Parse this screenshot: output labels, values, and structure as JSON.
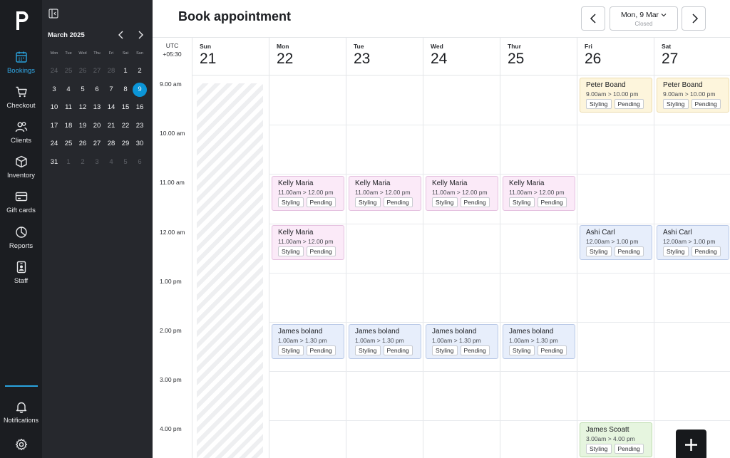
{
  "nav": {
    "items": [
      {
        "label": "Bookings",
        "icon": "calendar-icon"
      },
      {
        "label": "Checkout",
        "icon": "cart-icon"
      },
      {
        "label": "Clients",
        "icon": "users-icon"
      },
      {
        "label": "Inventory",
        "icon": "box-icon"
      },
      {
        "label": "Gift cards",
        "icon": "card-icon"
      },
      {
        "label": "Reports",
        "icon": "pie-chart-icon"
      },
      {
        "label": "Staff",
        "icon": "badge-icon"
      }
    ],
    "bottom": [
      {
        "label": "Notifications",
        "icon": "bell-icon"
      },
      {
        "label": "",
        "icon": "gear-icon"
      }
    ],
    "accent": "#2aa3de"
  },
  "mini_calendar": {
    "month": "March 2025",
    "weekdays": [
      "Mon",
      "Tue",
      "Wed",
      "Thu",
      "Fri",
      "Sat",
      "Sun"
    ],
    "days": [
      {
        "d": "24",
        "muted": true
      },
      {
        "d": "25",
        "muted": true
      },
      {
        "d": "26",
        "muted": true
      },
      {
        "d": "27",
        "muted": true
      },
      {
        "d": "28",
        "muted": true
      },
      {
        "d": "1"
      },
      {
        "d": "2"
      },
      {
        "d": "3"
      },
      {
        "d": "4"
      },
      {
        "d": "5"
      },
      {
        "d": "6"
      },
      {
        "d": "7"
      },
      {
        "d": "8"
      },
      {
        "d": "9",
        "selected": true
      },
      {
        "d": "10"
      },
      {
        "d": "11"
      },
      {
        "d": "12"
      },
      {
        "d": "13"
      },
      {
        "d": "14"
      },
      {
        "d": "15"
      },
      {
        "d": "16"
      },
      {
        "d": "17"
      },
      {
        "d": "18"
      },
      {
        "d": "19"
      },
      {
        "d": "20"
      },
      {
        "d": "21"
      },
      {
        "d": "22"
      },
      {
        "d": "23"
      },
      {
        "d": "24"
      },
      {
        "d": "25"
      },
      {
        "d": "26"
      },
      {
        "d": "27"
      },
      {
        "d": "28"
      },
      {
        "d": "29"
      },
      {
        "d": "30"
      },
      {
        "d": "31"
      },
      {
        "d": "1",
        "muted": true
      },
      {
        "d": "2",
        "muted": true
      },
      {
        "d": "3",
        "muted": true
      },
      {
        "d": "4",
        "muted": true
      },
      {
        "d": "5",
        "muted": true
      },
      {
        "d": "6",
        "muted": true
      }
    ],
    "selected_color": "#0b95d7"
  },
  "header": {
    "title": "Book appointment",
    "date_label": "Mon, 9 Mar",
    "date_status": "Closed"
  },
  "grid": {
    "timezone": [
      "UTC",
      "+05:30"
    ],
    "days": [
      {
        "name": "Sun",
        "num": "21"
      },
      {
        "name": "Mon",
        "num": "22"
      },
      {
        "name": "Tue",
        "num": "23"
      },
      {
        "name": "Wed",
        "num": "24"
      },
      {
        "name": "Thur",
        "num": "25"
      },
      {
        "name": "Fri",
        "num": "26"
      },
      {
        "name": "Sat",
        "num": "27"
      }
    ],
    "times": [
      "9.00 am",
      "10.00 am",
      "11.00 am",
      "12.00 am",
      "1.00 pm",
      "2.00 pm",
      "3.00 pm",
      "4.00 pm"
    ],
    "appointments": [
      {
        "day": 5,
        "slot": 0,
        "color": "yellow",
        "name": "Peter Boand",
        "time": "9.00am > 10.00 pm",
        "tags": [
          "Styling",
          "Pending"
        ]
      },
      {
        "day": 6,
        "slot": 0,
        "color": "yellow",
        "name": "Peter Boand",
        "time": "9.00am > 10.00 pm",
        "tags": [
          "Styling",
          "Pending"
        ]
      },
      {
        "day": 1,
        "slot": 2,
        "color": "pink",
        "name": "Kelly Maria",
        "time": "11.00am > 12.00 pm",
        "tags": [
          "Styling",
          "Pending"
        ]
      },
      {
        "day": 2,
        "slot": 2,
        "color": "pink",
        "name": "Kelly Maria",
        "time": "11.00am > 12.00 pm",
        "tags": [
          "Styling",
          "Pending"
        ]
      },
      {
        "day": 3,
        "slot": 2,
        "color": "pink",
        "name": "Kelly Maria",
        "time": "11.00am > 12.00 pm",
        "tags": [
          "Styling",
          "Pending"
        ]
      },
      {
        "day": 4,
        "slot": 2,
        "color": "pink",
        "name": "Kelly Maria",
        "time": "11.00am > 12.00 pm",
        "tags": [
          "Styling",
          "Pending"
        ]
      },
      {
        "day": 1,
        "slot": 3,
        "color": "pink",
        "name": "Kelly Maria",
        "time": "11.00am > 12.00 pm",
        "tags": [
          "Styling",
          "Pending"
        ]
      },
      {
        "day": 5,
        "slot": 3,
        "color": "blue",
        "name": "Ashi Carl",
        "time": "12.00am > 1.00 pm",
        "tags": [
          "Styling",
          "Pending"
        ]
      },
      {
        "day": 6,
        "slot": 3,
        "color": "blue",
        "name": "Ashi Carl",
        "time": "12.00am > 1.00 pm",
        "tags": [
          "Styling",
          "Pending"
        ]
      },
      {
        "day": 1,
        "slot": 5,
        "color": "blue",
        "name": "James boland",
        "time": "1.00am > 1.30 pm",
        "tags": [
          "Styling",
          "Pending"
        ]
      },
      {
        "day": 2,
        "slot": 5,
        "color": "blue",
        "name": "James boland",
        "time": "1.00am > 1.30 pm",
        "tags": [
          "Styling",
          "Pending"
        ]
      },
      {
        "day": 3,
        "slot": 5,
        "color": "blue",
        "name": "James boland",
        "time": "1.00am > 1.30 pm",
        "tags": [
          "Styling",
          "Pending"
        ]
      },
      {
        "day": 4,
        "slot": 5,
        "color": "blue",
        "name": "James boland",
        "time": "1.00am > 1.30 pm",
        "tags": [
          "Styling",
          "Pending"
        ]
      },
      {
        "day": 5,
        "slot": 7,
        "color": "green",
        "name": "James Scoatt",
        "time": "3.00am > 4.00 pm",
        "tags": [
          "Styling",
          "Pending"
        ]
      }
    ]
  }
}
